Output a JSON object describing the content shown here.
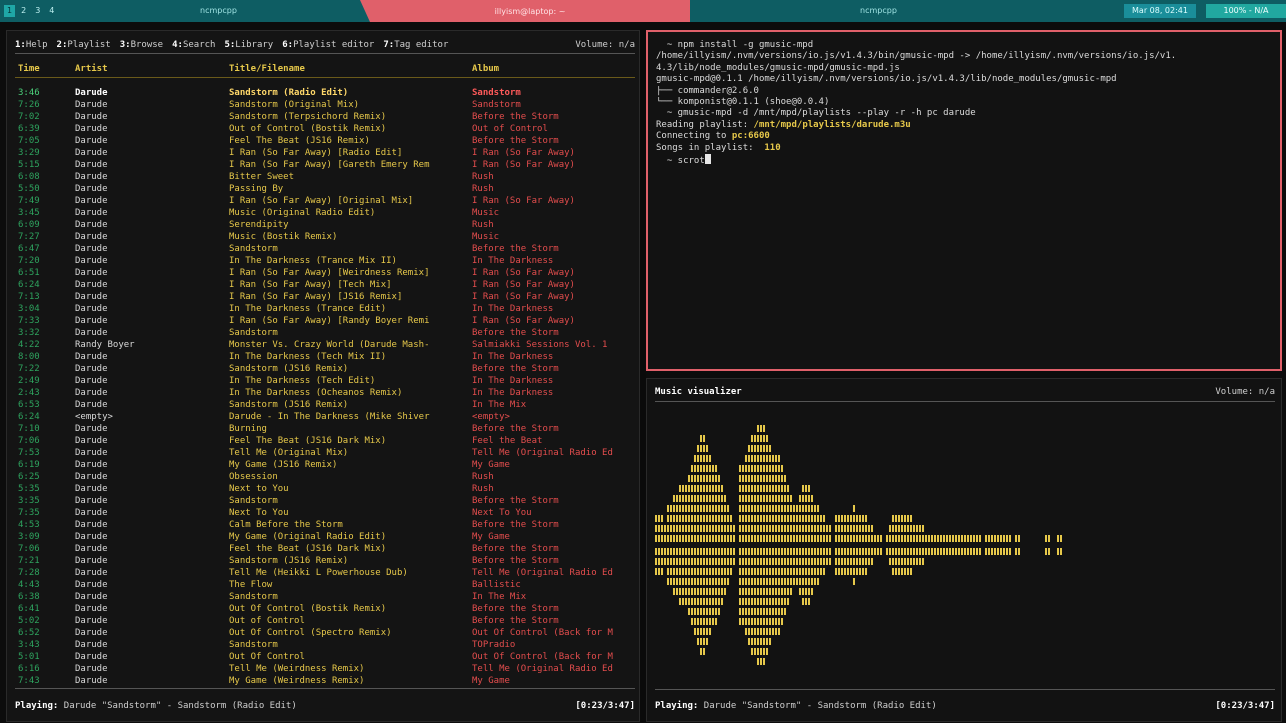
{
  "topbar": {
    "workspaces": [
      "1",
      "2",
      "3",
      "4"
    ],
    "active_workspace": 0,
    "left_title": "ncmpcpp",
    "mid_title": "illyism@laptop: ~",
    "right_title": "ncmpcpp",
    "date": "Mar 08, 02:41",
    "battery": "100% - N/A",
    "colors": {
      "teal": "#0e5d63",
      "accent": "#e0606a"
    }
  },
  "playlist_pane": {
    "menu": [
      {
        "key": "1:",
        "label": "Help"
      },
      {
        "key": "2:",
        "label": "Playlist"
      },
      {
        "key": "3:",
        "label": "Browse"
      },
      {
        "key": "4:",
        "label": "Search"
      },
      {
        "key": "5:",
        "label": "Library"
      },
      {
        "key": "6:",
        "label": "Playlist editor"
      },
      {
        "key": "7:",
        "label": "Tag editor"
      }
    ],
    "volume": "Volume: n/a",
    "columns": {
      "time": "Time",
      "artist": "Artist",
      "title": "Title/Filename",
      "album": "Album"
    },
    "rows": [
      {
        "time": "3:46",
        "artist": "Darude",
        "title": "Sandstorm (Radio Edit)",
        "album": "Sandstorm",
        "playing": true
      },
      {
        "time": "7:26",
        "artist": "Darude",
        "title": "Sandstorm (Original Mix)",
        "album": "Sandstorm"
      },
      {
        "time": "7:02",
        "artist": "Darude",
        "title": "Sandstorm (Terpsichord Remix)",
        "album": "Before the Storm"
      },
      {
        "time": "6:39",
        "artist": "Darude",
        "title": "Out of Control (Bostik Remix)",
        "album": "Out of Control"
      },
      {
        "time": "7:05",
        "artist": "Darude",
        "title": "Feel The Beat (JS16 Remix)",
        "album": "Before the Storm"
      },
      {
        "time": "3:29",
        "artist": "Darude",
        "title": "I Ran (So Far Away) [Radio Edit]",
        "album": "I Ran (So Far Away)"
      },
      {
        "time": "5:15",
        "artist": "Darude",
        "title": "I Ran (So Far Away) [Gareth Emery Rem",
        "album": "I Ran (So Far Away)"
      },
      {
        "time": "6:08",
        "artist": "Darude",
        "title": "Bitter Sweet",
        "album": "Rush"
      },
      {
        "time": "5:50",
        "artist": "Darude",
        "title": "Passing By",
        "album": "Rush"
      },
      {
        "time": "7:49",
        "artist": "Darude",
        "title": "I Ran (So Far Away) [Original Mix]",
        "album": "I Ran (So Far Away)"
      },
      {
        "time": "3:45",
        "artist": "Darude",
        "title": "Music (Original Radio Edit)",
        "album": "Music"
      },
      {
        "time": "6:09",
        "artist": "Darude",
        "title": "Serendipity",
        "album": "Rush"
      },
      {
        "time": "7:27",
        "artist": "Darude",
        "title": "Music (Bostik Remix)",
        "album": "Music"
      },
      {
        "time": "6:47",
        "artist": "Darude",
        "title": "Sandstorm",
        "album": "Before the Storm"
      },
      {
        "time": "7:20",
        "artist": "Darude",
        "title": "In The Darkness (Trance Mix II)",
        "album": "In The Darkness"
      },
      {
        "time": "6:51",
        "artist": "Darude",
        "title": "I Ran (So Far Away) [Weirdness Remix]",
        "album": "I Ran (So Far Away)"
      },
      {
        "time": "6:24",
        "artist": "Darude",
        "title": "I Ran (So Far Away) [Tech Mix]",
        "album": "I Ran (So Far Away)"
      },
      {
        "time": "7:13",
        "artist": "Darude",
        "title": "I Ran (So Far Away) [JS16 Remix]",
        "album": "I Ran (So Far Away)"
      },
      {
        "time": "3:04",
        "artist": "Darude",
        "title": "In The Darkness (Trance Edit)",
        "album": "In The Darkness"
      },
      {
        "time": "7:33",
        "artist": "Darude",
        "title": "I Ran (So Far Away) [Randy Boyer Remi",
        "album": "I Ran (So Far Away)"
      },
      {
        "time": "3:32",
        "artist": "Darude",
        "title": "Sandstorm",
        "album": "Before the Storm"
      },
      {
        "time": "4:22",
        "artist": "Randy Boyer",
        "title": "Monster Vs. Crazy World (Darude Mash-",
        "album": "Salmiakki Sessions Vol. 1"
      },
      {
        "time": "8:00",
        "artist": "Darude",
        "title": "In The Darkness (Tech Mix II)",
        "album": "In The Darkness"
      },
      {
        "time": "7:22",
        "artist": "Darude",
        "title": "Sandstorm (JS16 Remix)",
        "album": "Before the Storm"
      },
      {
        "time": "2:49",
        "artist": "Darude",
        "title": "In The Darkness (Tech Edit)",
        "album": "In The Darkness"
      },
      {
        "time": "2:43",
        "artist": "Darude",
        "title": "In The Darkness (Ocheanos Remix)",
        "album": "In The Darkness"
      },
      {
        "time": "6:53",
        "artist": "Darude",
        "title": "Sandstorm (JS16 Remix)",
        "album": "In The Mix"
      },
      {
        "time": "6:24",
        "artist": "<empty>",
        "title": "Darude - In The Darkness (Mike Shiver",
        "album": "<empty>"
      },
      {
        "time": "7:10",
        "artist": "Darude",
        "title": "Burning",
        "album": "Before the Storm"
      },
      {
        "time": "7:06",
        "artist": "Darude",
        "title": "Feel The Beat (JS16 Dark Mix)",
        "album": "Feel the Beat"
      },
      {
        "time": "7:53",
        "artist": "Darude",
        "title": "Tell Me (Original Mix)",
        "album": "Tell Me (Original Radio Ed"
      },
      {
        "time": "6:19",
        "artist": "Darude",
        "title": "My Game (JS16 Remix)",
        "album": "My Game"
      },
      {
        "time": "6:25",
        "artist": "Darude",
        "title": "Obsession",
        "album": "Rush"
      },
      {
        "time": "5:35",
        "artist": "Darude",
        "title": "Next to You",
        "album": "Rush"
      },
      {
        "time": "3:35",
        "artist": "Darude",
        "title": "Sandstorm",
        "album": "Before the Storm"
      },
      {
        "time": "7:35",
        "artist": "Darude",
        "title": "Next To You",
        "album": "Next To You"
      },
      {
        "time": "4:53",
        "artist": "Darude",
        "title": "Calm Before the Storm",
        "album": "Before the Storm"
      },
      {
        "time": "3:09",
        "artist": "Darude",
        "title": "My Game (Original Radio Edit)",
        "album": "My Game"
      },
      {
        "time": "7:06",
        "artist": "Darude",
        "title": "Feel the Beat (JS16 Dark Mix)",
        "album": "Before the Storm"
      },
      {
        "time": "7:21",
        "artist": "Darude",
        "title": "Sandstorm (JS16 Remix)",
        "album": "Before the Storm"
      },
      {
        "time": "7:28",
        "artist": "Darude",
        "title": "Tell Me (Heikki L Powerhouse Dub)",
        "album": "Tell Me (Original Radio Ed"
      },
      {
        "time": "4:43",
        "artist": "Darude",
        "title": "The Flow",
        "album": "Ballistic"
      },
      {
        "time": "6:38",
        "artist": "Darude",
        "title": "Sandstorm",
        "album": "In The Mix"
      },
      {
        "time": "6:41",
        "artist": "Darude",
        "title": "Out Of Control (Bostik Remix)",
        "album": "Before the Storm"
      },
      {
        "time": "5:02",
        "artist": "Darude",
        "title": "Out of Control",
        "album": "Before the Storm"
      },
      {
        "time": "6:52",
        "artist": "Darude",
        "title": "Out Of Control (Spectro Remix)",
        "album": "Out Of Control (Back for M"
      },
      {
        "time": "3:43",
        "artist": "Darude",
        "title": "Sandstorm",
        "album": "TOPradio"
      },
      {
        "time": "5:01",
        "artist": "Darude",
        "title": "Out Of Control",
        "album": "Out Of Control (Back for M"
      },
      {
        "time": "6:16",
        "artist": "Darude",
        "title": "Tell Me (Weirdness Remix)",
        "album": "Tell Me (Original Radio Ed"
      },
      {
        "time": "7:43",
        "artist": "Darude",
        "title": "My Game (Weirdness Remix)",
        "album": "My Game"
      }
    ],
    "progress": 0.12,
    "status_prefix": "Playing:",
    "status_text": " Darude \"Sandstorm\" - Sandstorm (Radio Edit)",
    "status_time": "[0:23/3:47]"
  },
  "terminal": {
    "lines": [
      [
        {
          "t": "  ~ npm install -g gmusic-mpd"
        }
      ],
      [
        {
          "t": "/home/illyism/.nvm/versions/io.js/v1.4.3/bin/gmusic-mpd -> /home/illyism/.nvm/versions/io.js/v1."
        }
      ],
      [
        {
          "t": "4.3/lib/node_modules/gmusic-mpd/gmusic-mpd.js"
        }
      ],
      [
        {
          "t": "gmusic-mpd@0.1.1 /home/illyism/.nvm/versions/io.js/v1.4.3/lib/node_modules/gmusic-mpd"
        }
      ],
      [
        {
          "t": "├── commander@2.6.0"
        }
      ],
      [
        {
          "t": "└── komponist@0.1.1 (shoe@0.0.4)"
        }
      ],
      [
        {
          "t": "  ~ gmusic-mpd -d /mnt/mpd/playlists --play -r -h pc darude"
        }
      ],
      [
        {
          "t": "Reading playlist: "
        },
        {
          "t": "/mnt/mpd/playlists/darude.m3u",
          "c": "hl-y"
        }
      ],
      [
        {
          "t": "Connecting to "
        },
        {
          "t": "pc:6600",
          "c": "hl-y"
        }
      ],
      [
        {
          "t": "Songs in playlist:  "
        },
        {
          "t": "110",
          "c": "hl-y"
        }
      ],
      [
        {
          "t": "  ~ scrot"
        },
        {
          "cursor": true
        }
      ]
    ]
  },
  "visualizer": {
    "title": "Music visualizer",
    "volume": "Volume: n/a",
    "color": "#e6c84a",
    "levels": [
      3,
      3,
      3,
      2,
      4,
      4,
      5,
      5,
      6,
      6,
      6,
      7,
      8,
      9,
      10,
      11,
      11,
      10,
      9,
      8,
      8,
      7,
      6,
      5,
      4,
      3,
      2,
      0,
      8,
      8,
      9,
      10,
      11,
      11,
      12,
      12,
      12,
      11,
      10,
      9,
      9,
      9,
      8,
      7,
      6,
      5,
      4,
      4,
      5,
      6,
      6,
      6,
      5,
      4,
      4,
      3,
      3,
      2,
      2,
      0,
      3,
      3,
      3,
      3,
      3,
      3,
      4,
      3,
      3,
      3,
      3,
      2,
      2,
      1,
      1,
      1,
      0,
      1,
      2,
      3,
      3,
      3,
      3,
      3,
      3,
      3,
      2,
      2,
      2,
      2,
      1,
      1,
      1,
      1,
      1,
      1,
      1,
      1,
      1,
      1,
      1,
      1,
      1,
      1,
      1,
      1,
      1,
      1,
      1,
      0,
      1,
      1,
      1,
      1,
      1,
      1,
      1,
      1,
      1,
      0,
      1,
      1,
      0,
      0,
      0,
      0,
      0,
      0,
      0,
      0,
      1,
      1,
      0,
      0,
      1,
      1,
      0,
      0,
      0,
      0,
      0,
      0,
      0,
      0,
      0,
      0,
      0,
      0,
      0,
      0,
      0,
      0,
      0,
      0,
      0,
      0,
      0,
      0,
      0,
      0,
      0,
      0,
      0,
      0,
      0,
      0,
      0,
      0,
      0,
      0,
      0,
      0,
      0,
      0,
      0,
      0,
      0,
      0,
      0,
      0,
      0,
      0,
      0,
      0,
      0,
      0,
      0,
      0,
      0,
      0,
      0,
      0,
      0,
      0,
      0,
      0,
      0,
      0,
      0,
      0,
      0,
      0,
      0,
      0,
      0,
      0,
      0,
      0,
      0,
      0,
      0,
      0,
      0,
      0,
      0,
      0
    ],
    "progress": 0.12,
    "status_prefix": "Playing:",
    "status_text": " Darude \"Sandstorm\" - Sandstorm (Radio Edit)",
    "status_time": "[0:23/3:47]"
  }
}
